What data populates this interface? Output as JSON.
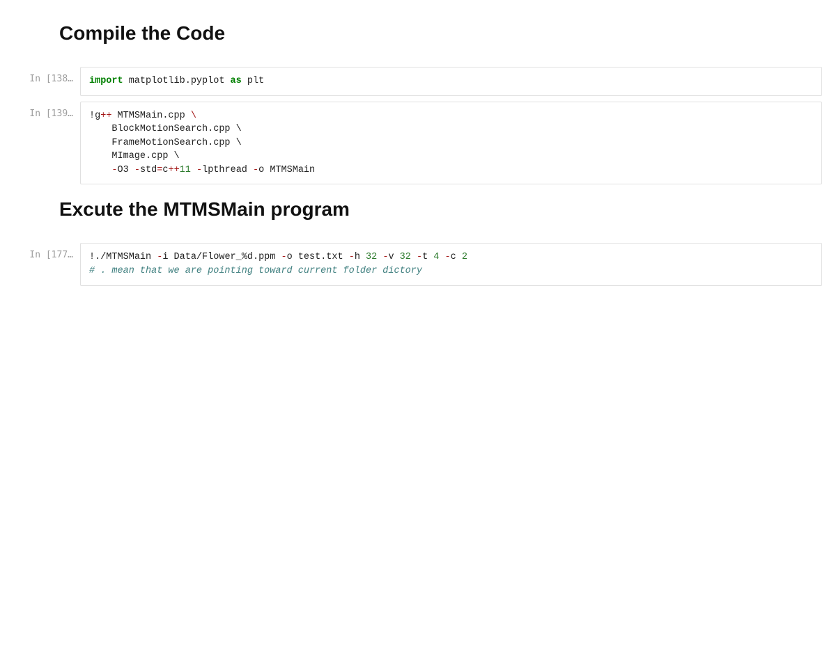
{
  "cells": [
    {
      "type": "markdown",
      "heading": "Compile the Code"
    },
    {
      "type": "code",
      "prompt": "In [138…",
      "tokens": [
        [
          {
            "t": "import",
            "cls": "tok-keyword"
          },
          {
            "t": " matplotlib.pyplot ",
            "cls": "tok-module"
          },
          {
            "t": "as",
            "cls": "tok-keyword"
          },
          {
            "t": " plt",
            "cls": "tok-module"
          }
        ]
      ]
    },
    {
      "type": "code",
      "prompt": "In [139…",
      "tokens": [
        [
          {
            "t": "!",
            "cls": "tok-bang"
          },
          {
            "t": "g",
            "cls": "tok-module"
          },
          {
            "t": "++",
            "cls": "tok-operator"
          },
          {
            "t": " MTMSMain.cpp ",
            "cls": "tok-module"
          },
          {
            "t": "\\",
            "cls": "tok-continuation"
          }
        ],
        [
          {
            "t": "    BlockMotionSearch.cpp \\",
            "cls": "tok-continuation2"
          }
        ],
        [
          {
            "t": "    FrameMotionSearch.cpp \\",
            "cls": "tok-continuation2"
          }
        ],
        [
          {
            "t": "    MImage.cpp \\",
            "cls": "tok-continuation2"
          }
        ],
        [
          {
            "t": "    ",
            "cls": "tok-module"
          },
          {
            "t": "-",
            "cls": "tok-minus"
          },
          {
            "t": "O3 ",
            "cls": "tok-module"
          },
          {
            "t": "-",
            "cls": "tok-minus"
          },
          {
            "t": "std",
            "cls": "tok-module"
          },
          {
            "t": "=",
            "cls": "tok-operator"
          },
          {
            "t": "c",
            "cls": "tok-module"
          },
          {
            "t": "++",
            "cls": "tok-operator"
          },
          {
            "t": "11",
            "cls": "tok-number"
          },
          {
            "t": " ",
            "cls": "tok-module"
          },
          {
            "t": "-",
            "cls": "tok-minus"
          },
          {
            "t": "lpthread ",
            "cls": "tok-module"
          },
          {
            "t": "-",
            "cls": "tok-minus"
          },
          {
            "t": "o MTMSMain",
            "cls": "tok-module"
          }
        ]
      ]
    },
    {
      "type": "markdown",
      "heading": "Excute the MTMSMain program"
    },
    {
      "type": "code",
      "prompt": "In [177…",
      "tokens": [
        [
          {
            "t": "!",
            "cls": "tok-bang"
          },
          {
            "t": "./MTMSMain ",
            "cls": "tok-module"
          },
          {
            "t": "-",
            "cls": "tok-minus"
          },
          {
            "t": "i Data/Flower_%d.ppm ",
            "cls": "tok-module"
          },
          {
            "t": "-",
            "cls": "tok-minus"
          },
          {
            "t": "o test.txt ",
            "cls": "tok-module"
          },
          {
            "t": "-",
            "cls": "tok-minus"
          },
          {
            "t": "h ",
            "cls": "tok-module"
          },
          {
            "t": "32",
            "cls": "tok-number"
          },
          {
            "t": " ",
            "cls": "tok-module"
          },
          {
            "t": "-",
            "cls": "tok-minus"
          },
          {
            "t": "v ",
            "cls": "tok-module"
          },
          {
            "t": "32",
            "cls": "tok-number"
          },
          {
            "t": " ",
            "cls": "tok-module"
          },
          {
            "t": "-",
            "cls": "tok-minus"
          },
          {
            "t": "t ",
            "cls": "tok-module"
          },
          {
            "t": "4",
            "cls": "tok-number"
          },
          {
            "t": " ",
            "cls": "tok-module"
          },
          {
            "t": "-",
            "cls": "tok-minus"
          },
          {
            "t": "c ",
            "cls": "tok-module"
          },
          {
            "t": "2",
            "cls": "tok-number"
          }
        ],
        [
          {
            "t": "# . mean that we are pointing toward current folder dictory",
            "cls": "tok-comment"
          }
        ]
      ]
    }
  ]
}
